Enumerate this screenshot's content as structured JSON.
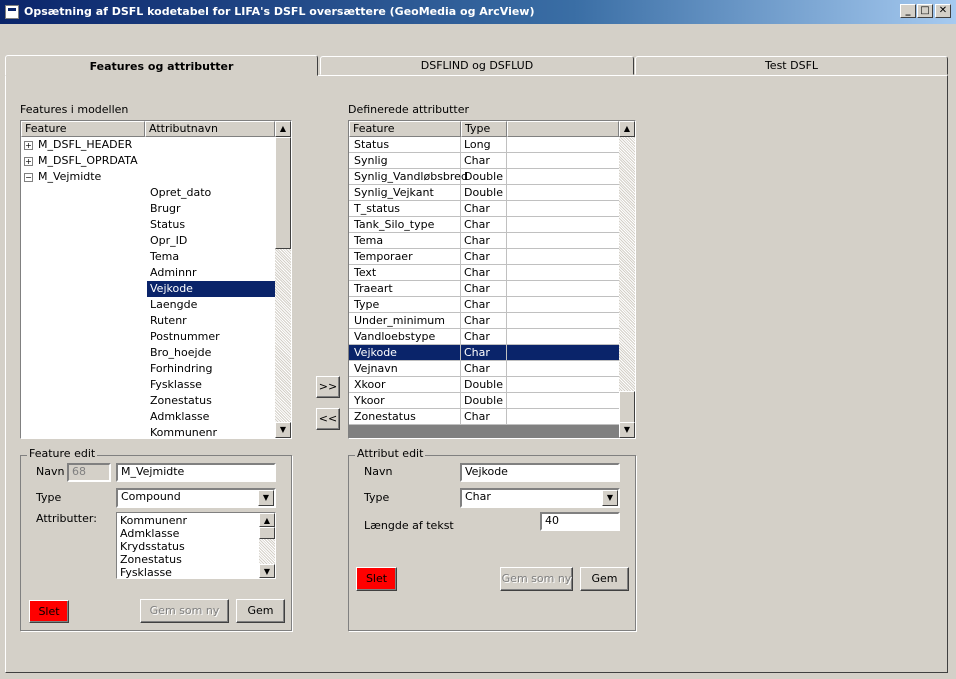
{
  "window": {
    "title": "Opsætning af DSFL kodetabel for LIFA's DSFL oversættere (GeoMedia og ArcView)",
    "min_glyph": "_",
    "max_glyph": "□",
    "close_glyph": "✕"
  },
  "tabs": [
    {
      "label": "Features og attributter"
    },
    {
      "label": "DSFLIND og DSFLUD"
    },
    {
      "label": "Test DSFL"
    }
  ],
  "features_panel": {
    "label": "Features i modellen",
    "columns": [
      "Feature",
      "Attributnavn"
    ],
    "rows": [
      {
        "expander": "+",
        "feature": "M_DSFL_HEADER",
        "attr": ""
      },
      {
        "expander": "+",
        "feature": "M_DSFL_OPRDATA",
        "attr": ""
      },
      {
        "expander": "−",
        "feature": "M_Vejmidte",
        "attr": ""
      },
      {
        "expander": "",
        "feature": "",
        "attr": "Opret_dato"
      },
      {
        "expander": "",
        "feature": "",
        "attr": "Brugr"
      },
      {
        "expander": "",
        "feature": "",
        "attr": "Status"
      },
      {
        "expander": "",
        "feature": "",
        "attr": "Opr_ID"
      },
      {
        "expander": "",
        "feature": "",
        "attr": "Tema"
      },
      {
        "expander": "",
        "feature": "",
        "attr": "Adminnr"
      },
      {
        "expander": "",
        "feature": "",
        "attr": "Vejkode"
      },
      {
        "expander": "",
        "feature": "",
        "attr": "Laengde"
      },
      {
        "expander": "",
        "feature": "",
        "attr": "Rutenr"
      },
      {
        "expander": "",
        "feature": "",
        "attr": "Postnummer"
      },
      {
        "expander": "",
        "feature": "",
        "attr": "Bro_hoejde"
      },
      {
        "expander": "",
        "feature": "",
        "attr": "Forhindring"
      },
      {
        "expander": "",
        "feature": "",
        "attr": "Fysklasse"
      },
      {
        "expander": "",
        "feature": "",
        "attr": "Zonestatus"
      },
      {
        "expander": "",
        "feature": "",
        "attr": "Admklasse"
      },
      {
        "expander": "",
        "feature": "",
        "attr": "Kommunenr"
      }
    ],
    "selected_index": 9
  },
  "attributes_panel": {
    "label": "Definerede attributter",
    "columns": [
      "Feature",
      "Type"
    ],
    "rows": [
      {
        "name": "Status",
        "type": "Long"
      },
      {
        "name": "Synlig",
        "type": "Char"
      },
      {
        "name": "Synlig_Vandløbsbred",
        "type": "Double"
      },
      {
        "name": "Synlig_Vejkant",
        "type": "Double"
      },
      {
        "name": "T_status",
        "type": "Char"
      },
      {
        "name": "Tank_Silo_type",
        "type": "Char"
      },
      {
        "name": "Tema",
        "type": "Char"
      },
      {
        "name": "Temporaer",
        "type": "Char"
      },
      {
        "name": "Text",
        "type": "Char"
      },
      {
        "name": "Traeart",
        "type": "Char"
      },
      {
        "name": "Type",
        "type": "Char"
      },
      {
        "name": "Under_minimum",
        "type": "Char"
      },
      {
        "name": "Vandloebstype",
        "type": "Char"
      },
      {
        "name": "Vejkode",
        "type": "Char"
      },
      {
        "name": "Vejnavn",
        "type": "Char"
      },
      {
        "name": "Xkoor",
        "type": "Double"
      },
      {
        "name": "Ykoor",
        "type": "Double"
      },
      {
        "name": "Zonestatus",
        "type": "Char"
      }
    ],
    "selected_index": 13
  },
  "move_buttons": {
    "add": ">>",
    "remove": "<<"
  },
  "feature_edit": {
    "group_label": "Feature edit",
    "name_label": "Navn",
    "id_value": "68",
    "name_value": "M_Vejmidte",
    "type_label": "Type",
    "type_value": "Compound",
    "attributes_label": "Attributter:",
    "attributes": [
      "Kommunenr",
      "Admklasse",
      "Krydsstatus",
      "Zonestatus",
      "Fysklasse"
    ],
    "delete_label": "Slet",
    "save_new_label": "Gem som ny",
    "save_label": "Gem"
  },
  "attribute_edit": {
    "group_label": "Attribut  edit",
    "name_label": "Navn",
    "name_value": "Vejkode",
    "type_label": "Type",
    "type_value": "Char",
    "text_length_label": "Længde af tekst",
    "text_length_value": "40",
    "delete_label": "Slet",
    "save_new_label": "Gem som ny",
    "save_label": "Gem"
  },
  "icons": {
    "scroll_up": "▲",
    "scroll_down": "▼",
    "combo_arrow": "▼"
  }
}
